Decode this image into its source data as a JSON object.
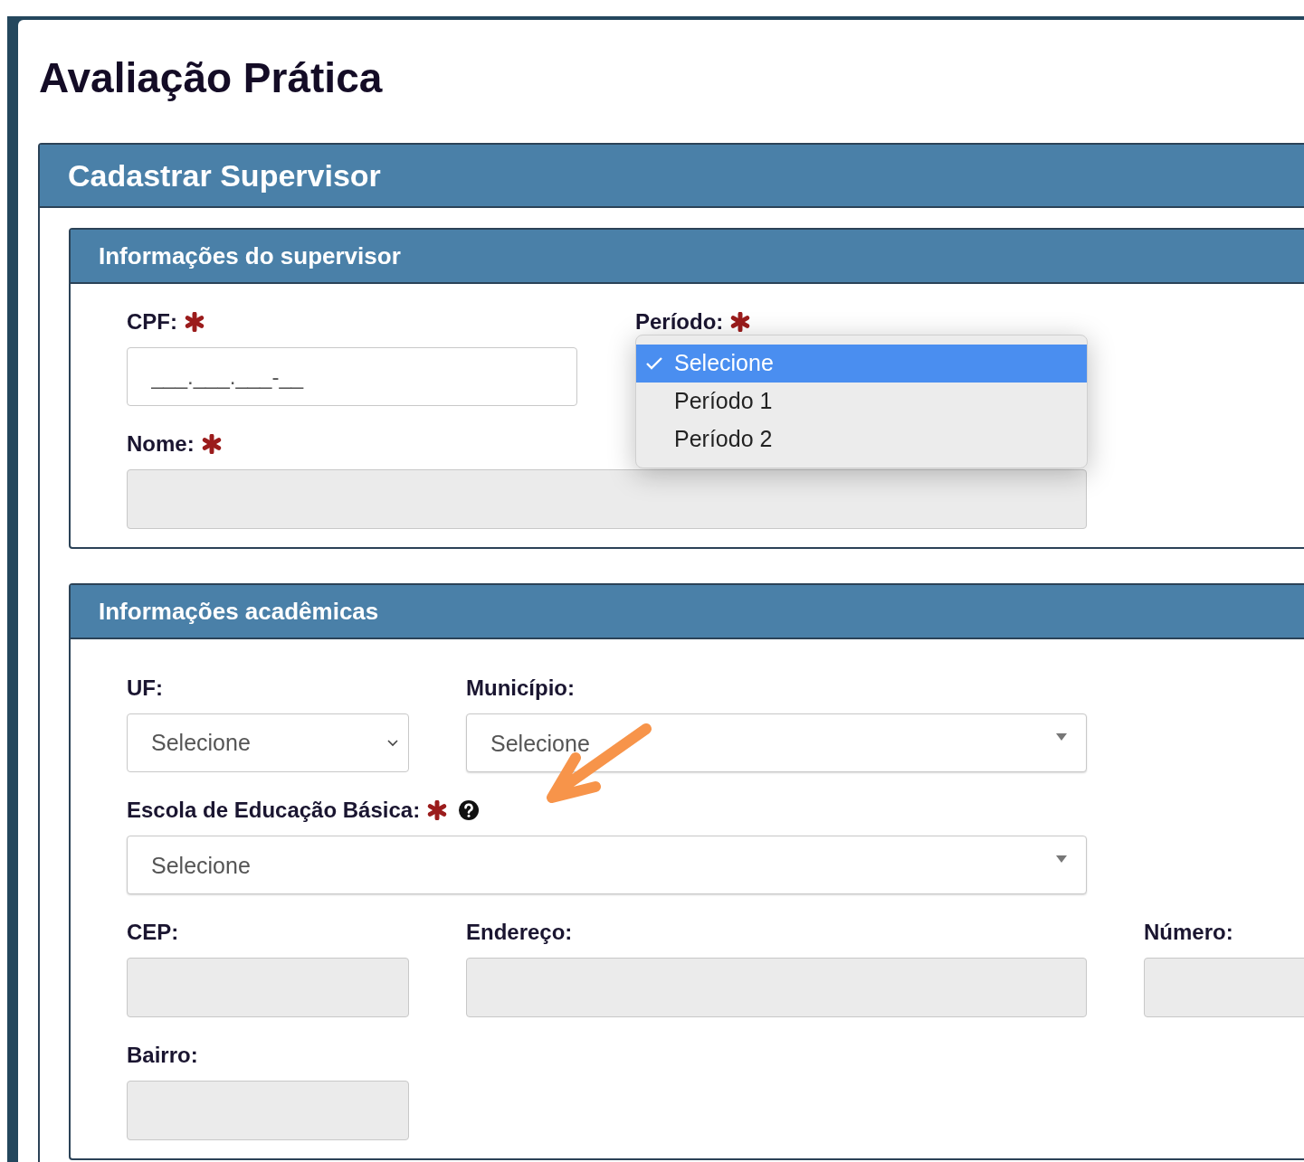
{
  "page": {
    "title": "Avaliação Prática"
  },
  "panel": {
    "title": "Cadastrar Supervisor"
  },
  "sections": [
    {
      "title": "Informações do supervisor",
      "rows": [
        [
          {
            "kind": "input",
            "label": "CPF:",
            "required": true,
            "placeholder": "___.___.___-__"
          },
          {
            "kind": "open-list",
            "label": "Período:",
            "required": true,
            "options": [
              {
                "label": "Selecione",
                "selected": true
              },
              {
                "label": "Período 1",
                "selected": false
              },
              {
                "label": "Período 2",
                "selected": false
              }
            ]
          }
        ],
        [
          {
            "kind": "readonly",
            "label": "Nome:",
            "required": true
          }
        ]
      ]
    },
    {
      "title": "Informações acadêmicas",
      "rows": [
        [
          {
            "kind": "select",
            "label": "UF:",
            "required": false,
            "value": "Selecione"
          },
          {
            "kind": "combo",
            "label": "Município:",
            "required": false,
            "value": "Selecione"
          }
        ],
        [
          {
            "kind": "combo",
            "label": "Escola de Educação Básica:",
            "required": true,
            "help": true,
            "value": "Selecione"
          }
        ],
        [
          {
            "kind": "readonly",
            "label": "CEP:",
            "required": false
          },
          {
            "kind": "readonly",
            "label": "Endereço:",
            "required": false
          },
          {
            "kind": "readonly",
            "label": "Número:",
            "required": false
          }
        ],
        [
          {
            "kind": "readonly",
            "label": "Bairro:",
            "required": false
          }
        ]
      ]
    }
  ]
}
